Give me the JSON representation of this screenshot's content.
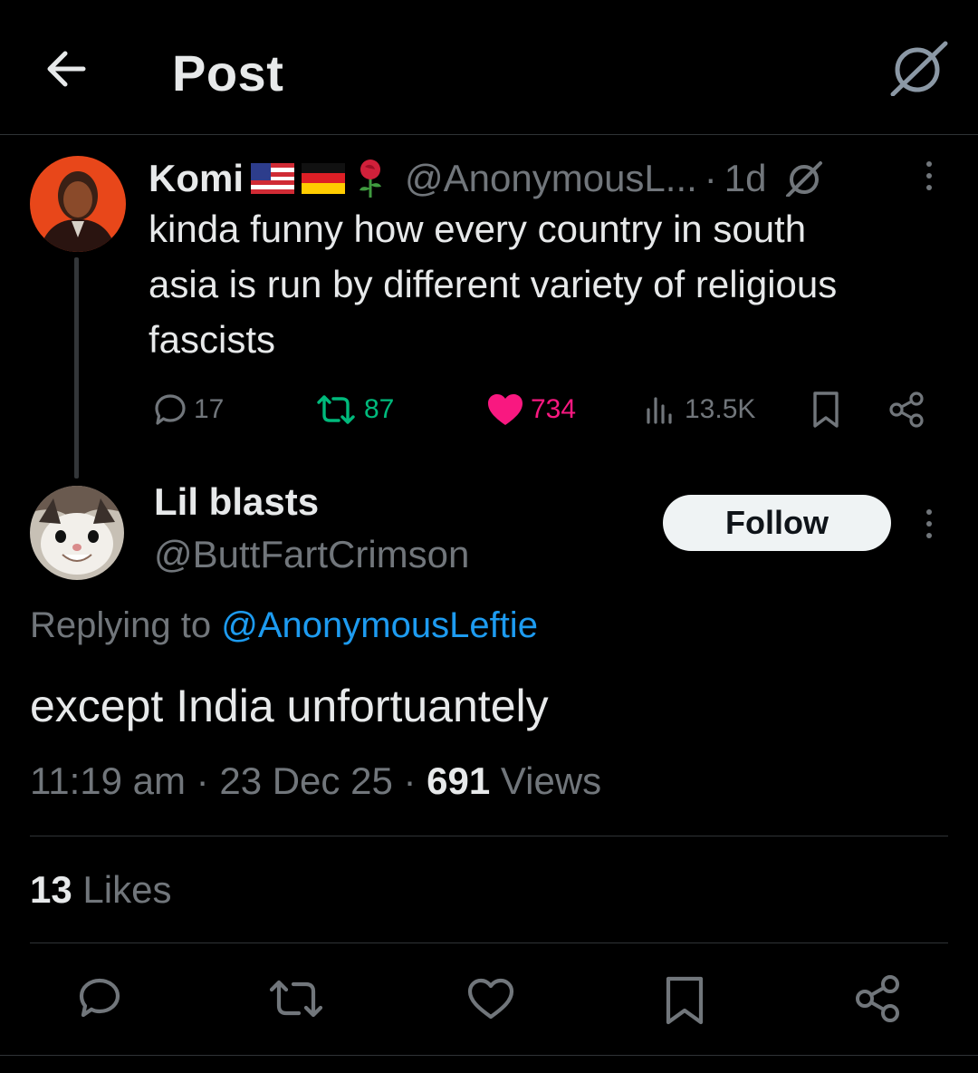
{
  "header": {
    "title": "Post",
    "back_icon": "arrow-left-icon",
    "grok_icon": "grok-icon"
  },
  "parent_tweet": {
    "name": "Komi",
    "flags": [
      "us-flag",
      "germany-flag",
      "rose-emoji"
    ],
    "handle": "@AnonymousL...",
    "separator": "·",
    "time": "1d",
    "text_lines": [
      "kinda funny how every country in south",
      "asia is run by different variety of religious",
      "fascists"
    ],
    "replies": "17",
    "reposts": "87",
    "likes": "734",
    "views": "13.5K",
    "colors": {
      "repost": "#00ba7c",
      "like": "#f91880",
      "muted": "#71767b"
    }
  },
  "reply": {
    "name": "Lil blasts",
    "handle": "@ButtFartCrimson",
    "follow_label": "Follow",
    "replying_prefix": "Replying to",
    "replying_handle": "@AnonymousLeftie",
    "text": "except India unfortuantely",
    "time": "11:19 am",
    "date": "23 Dec 25",
    "views_count": "691",
    "views_label": "Views",
    "meta_separator": "·",
    "likes_count": "13",
    "likes_label": "Likes",
    "colors": {
      "link": "#1d9bf0",
      "follow_bg": "#eff3f4"
    }
  },
  "bottom_actions": [
    "reply-icon",
    "repost-icon",
    "like-icon",
    "bookmark-icon",
    "share-icon"
  ]
}
